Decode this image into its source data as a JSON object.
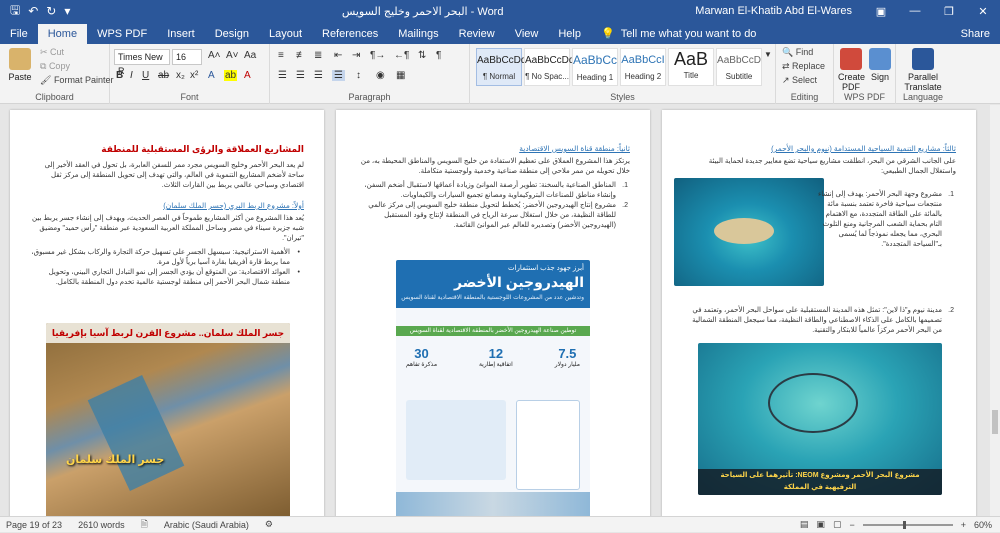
{
  "titlebar": {
    "doc_title": "البحر الاحمر وخليج السويس - Word",
    "user": "Marwan El-Khatib Abd El-Wares"
  },
  "tabs": [
    "File",
    "Home",
    "WPS PDF",
    "Insert",
    "Design",
    "Layout",
    "References",
    "Mailings",
    "Review",
    "View",
    "Help"
  ],
  "tell_me": "Tell me what you want to do",
  "share": "Share",
  "ribbon": {
    "clipboard": {
      "paste": "Paste",
      "cut": "Cut",
      "copy": "Copy",
      "format_painter": "Format Painter",
      "label": "Clipboard"
    },
    "font": {
      "name": "Times New R",
      "size": "16",
      "label": "Font"
    },
    "paragraph": {
      "label": "Paragraph"
    },
    "styles": {
      "label": "Styles",
      "items": [
        {
          "sample": "AaBbCcDd",
          "name": "¶ Normal"
        },
        {
          "sample": "AaBbCcDd",
          "name": "¶ No Spac..."
        },
        {
          "sample": "AaBbCc",
          "name": "Heading 1"
        },
        {
          "sample": "AaBbCcI",
          "name": "Heading 2"
        },
        {
          "sample": "AaB",
          "name": "Title"
        },
        {
          "sample": "AaBbCcD",
          "name": "Subtitle"
        }
      ]
    },
    "editing": {
      "find": "Find",
      "replace": "Replace",
      "select": "Select",
      "label": "Editing"
    },
    "wps": {
      "create": "Create PDF",
      "sign": "Sign",
      "label": "WPS PDF"
    },
    "language": {
      "translate": "Parallel Translate",
      "label": "Language"
    }
  },
  "page_left": {
    "heading": "المشاريع العملاقة والرؤى المستقبلية للمنطقة",
    "intro": "لم يعد البحر الأحمر وخليج السويس مجرد ممر للسفن العابرة، بل تحول في العقد الأخير إلى ساحة لأضخم المشاريع التنموية في العالم، والتي تهدف إلى تحويل المنطقة إلى مركز ثقل اقتصادي وسياحي عالمي يربط بين القارات الثلاث.",
    "sub1": "أولاً: مشروع الربط البري (جسر الملك سلمان)",
    "p1": "يُعد هذا المشروع من أكثر المشاريع طموحاً في العصر الحديث، ويهدف إلى إنشاء جسر يربط بين شبه جزيرة سيناء في مصر وساحل المملكة العربية السعودية عبر منطقة \"رأس حميد\" ومضيق \"تيران\".",
    "b1": "الأهمية الاستراتيجية: سيسهل الجسر على تسهيل حركة التجارة والركاب بشكل غير مسبوق، مما يربط قارة أفريقيا بقارة آسيا برياً لأول مرة.",
    "b2": "العوائد الاقتصادية: من المتوقع أن يؤدي الجسر إلى نمو التبادل التجاري البيني، وتحويل منطقة شمال البحر الأحمر إلى منطقة لوجستية عالمية تخدم دول المنطقة بالكامل.",
    "banner": "جسر الملك سلمان.. مشروع القرن لربط آسيا بإفريقيا",
    "map_label": "جسر الملك سلمان"
  },
  "page_mid": {
    "sub2": "ثانياً: منطقة قناة السويس الاقتصادية",
    "p2": "يرتكز هذا المشروع العملاق على تعظيم الاستفادة من خليج السويس والمناطق المحيطة به، من خلال تحويله من ممر ملاحي إلى منطقة صناعية وخدمية ولوجستية متكاملة.",
    "n1": "المناطق الصناعية بالسخنة: تطوير أرصفة الموانئ وزيادة أعماقها لاستقبال أضخم السفن، وإنشاء مناطق للصناعات البتروكيماوية ومصانع تجميع السيارات والكيماويات.",
    "n2": "مشروع إنتاج الهيدروجين الأخضر: يُخطط لتحويل منطقة خليج السويس إلى مركز عالمي للطاقة النظيفة، من خلال استغلال سرعة الرياح في المنطقة لإنتاج وقود المستقبل (الهيدروجين الأخضر) وتصديره للعالم عبر الموانئ القائمة.",
    "info_top": "أبرز جهود جذب استثمارات",
    "info_title": "الهيدروجين الأخضر",
    "info_sub": "وتدشين عدد من المشروعات اللوجستية بالمنطقة الاقتصادية لقناة السويس",
    "info_band": "توطين صناعة الهيدروجين الأخضر بالمنطقة الاقتصادية لقناة السويس",
    "stats": [
      {
        "value": "7.5",
        "label": "مليار دولار"
      },
      {
        "value": "12",
        "label": "اتفاقية إطارية"
      },
      {
        "value": "30",
        "label": "مذكرة تفاهم"
      }
    ]
  },
  "page_right": {
    "sub3": "ثالثاً: مشاريع التنمية السياحية المستدامة (نيوم والبحر الأحمر)",
    "p3": "على الجانب الشرقي من البحر، انطلقت مشاريع سياحية تضع معايير جديدة لحماية البيئة واستغلال الجمال الطبيعي:",
    "n1": "مشروع وجهة البحر الأحمر: يهدف إلى إنشاء منتجعات سياحية فاخرة تعتمد بنسبة مائة بالمائة على الطاقة المتجددة، مع الاهتمام التام بحماية الشعب المرجانية ومنع التلوث البحري، مما يجعله نموذجاً لما يُسمى بـ\"السياحة المتجددة\".",
    "n2": "مدينة نيوم و\"ذا لاين\": تمثل هذه المدينة المستقبلية على سواحل البحر الأحمر، وتعتمد في تصميمها بالكامل على الذكاء الاصطناعي والطاقة النظيفة، مما سيجعل المنطقة الشمالية من البحر الأحمر مركزاً عالمياً للابتكار والتقنية.",
    "caption": "مشروع البحر الأحمر ومشروع NEOM: تأثيرهما على السياحة الترفيهية في المملكة"
  },
  "status": {
    "page": "Page 19 of 23",
    "words": "2610 words",
    "lang": "Arabic (Saudi Arabia)",
    "zoom": "60%"
  },
  "colors": {
    "word_blue": "#2b579a",
    "heading_red": "#c00000",
    "heading_blue": "#2e74b5"
  }
}
